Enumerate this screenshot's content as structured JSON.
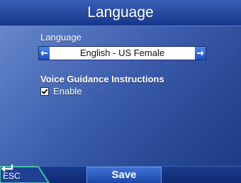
{
  "header": {
    "title": "Language"
  },
  "language": {
    "label": "Language",
    "selected": "English - US Female",
    "prev_icon": "left-arrow-icon",
    "next_icon": "right-arrow-icon"
  },
  "voice": {
    "label": "Voice Guidance Instructions",
    "enable_label": "Enable",
    "enabled": true
  },
  "footer": {
    "esc_label": "ESC",
    "esc_icon": "return-arrow-icon",
    "save_label": "Save"
  },
  "colors": {
    "accent": "#1d4fc0",
    "background": "#3b5cab",
    "text": "#ffffff"
  }
}
